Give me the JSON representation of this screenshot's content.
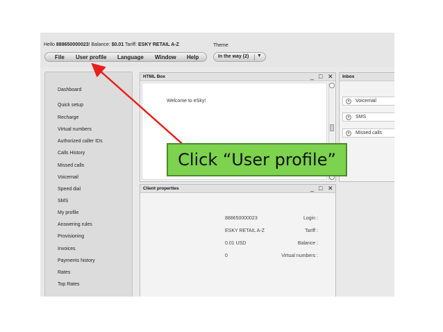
{
  "header": {
    "hello_prefix": "Hello ",
    "account": "888650000023",
    "balance_prefix": "! Balance: ",
    "balance": "$0.01",
    "tariff_prefix": " Tariff: ",
    "tariff": "ESKY RETAIL A-Z"
  },
  "menu": {
    "file": "File",
    "user_profile": "User profile",
    "language": "Language",
    "window": "Window",
    "help": "Help"
  },
  "theme": {
    "label": "Theme",
    "value": "In the way (2)",
    "arrow_icon": "chevron-down-icon"
  },
  "sidebar": {
    "items": [
      "Dashboard",
      "Quick setup",
      "Recharge",
      "Virtual numbers",
      "Authorized caller IDs",
      "Calls History",
      "Missed calls",
      "Voicemail",
      "Speed dial",
      "SMS",
      "My profile",
      "Answering rules",
      "Provisioning",
      "Invoices",
      "Payments history",
      "Rates",
      "Top Rates"
    ]
  },
  "html_box": {
    "title": "HTML Box",
    "welcome": "Welcome to eSky!"
  },
  "window_controls": {
    "minimize": "_",
    "maximize": "□",
    "close": "✕"
  },
  "client_properties": {
    "title": "Client properties",
    "rows": [
      {
        "label": "Login :",
        "value": "888650000023"
      },
      {
        "label": "Tariff :",
        "value": "ESKY RETAIL A-Z"
      },
      {
        "label": "Balance :",
        "value": "0.01 USD"
      },
      {
        "label": "Virtual numbers :",
        "value": "0"
      }
    ]
  },
  "inbox": {
    "title": "Inbox",
    "items": [
      "Voicemail",
      "SMS",
      "Missed calls"
    ],
    "item_icon": "double-chevron-down-icon",
    "item_icon_glyph": "»"
  },
  "annotation": {
    "callout_text": "Click “User profile”",
    "arrow_color": "#e8201c",
    "callout_color": "#7dd24e"
  }
}
